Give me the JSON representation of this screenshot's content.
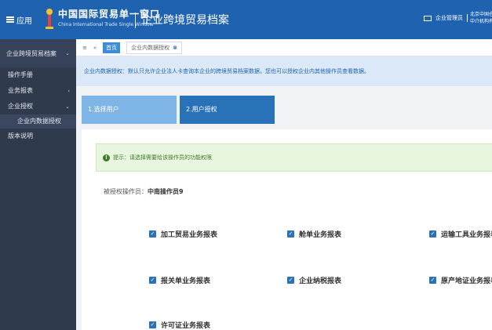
{
  "header": {
    "menu_label": "应用",
    "brand_cn": "中国国际贸易单一窗口",
    "brand_en": "China International Trade Single Window",
    "system_title": "企业跨境贸易档案",
    "user_label": "企业管理员",
    "org_line1": "北京中国仓储",
    "org_line2": "中介机构有限公司"
  },
  "sidebar": {
    "title": "企业跨境贸易档案",
    "items": [
      {
        "label": "操作手册",
        "chevron": ""
      },
      {
        "label": "业务报表",
        "chevron": "‹"
      },
      {
        "label": "企业授权",
        "chevron": "⌄"
      }
    ],
    "subitem": "企业内数据授权",
    "extra_item": "版本说明"
  },
  "tabs": {
    "nav_back": "≡",
    "nav_prev": "«",
    "home": "首页",
    "active": "企业内数据授权",
    "close": "⊗"
  },
  "notice": "企业内数据授权：默认只允许企业法人卡查询本企业的跨境贸易档案数据，您也可以授权企业内其他操作员查看数据。",
  "steps": [
    {
      "label": "1.选择用户"
    },
    {
      "label": "2.用户授权"
    }
  ],
  "tip": "提示：请选择需要给该操作员的功能权限",
  "operator": {
    "label": "被授权操作员：",
    "name": "中南操作员9"
  },
  "reports": [
    "加工贸易业务报表",
    "舱单业务报表",
    "运输工具业务报表",
    "报关单业务报表",
    "企业纳税报表",
    "原产地证业务报表",
    "许可证业务报表"
  ],
  "colors": {
    "header": "#1f63b0",
    "sidebar": "#2f3a4c",
    "step_done": "#7fb4e6",
    "step_active": "#2a72b8",
    "tip_bg": "#e9f6df"
  }
}
